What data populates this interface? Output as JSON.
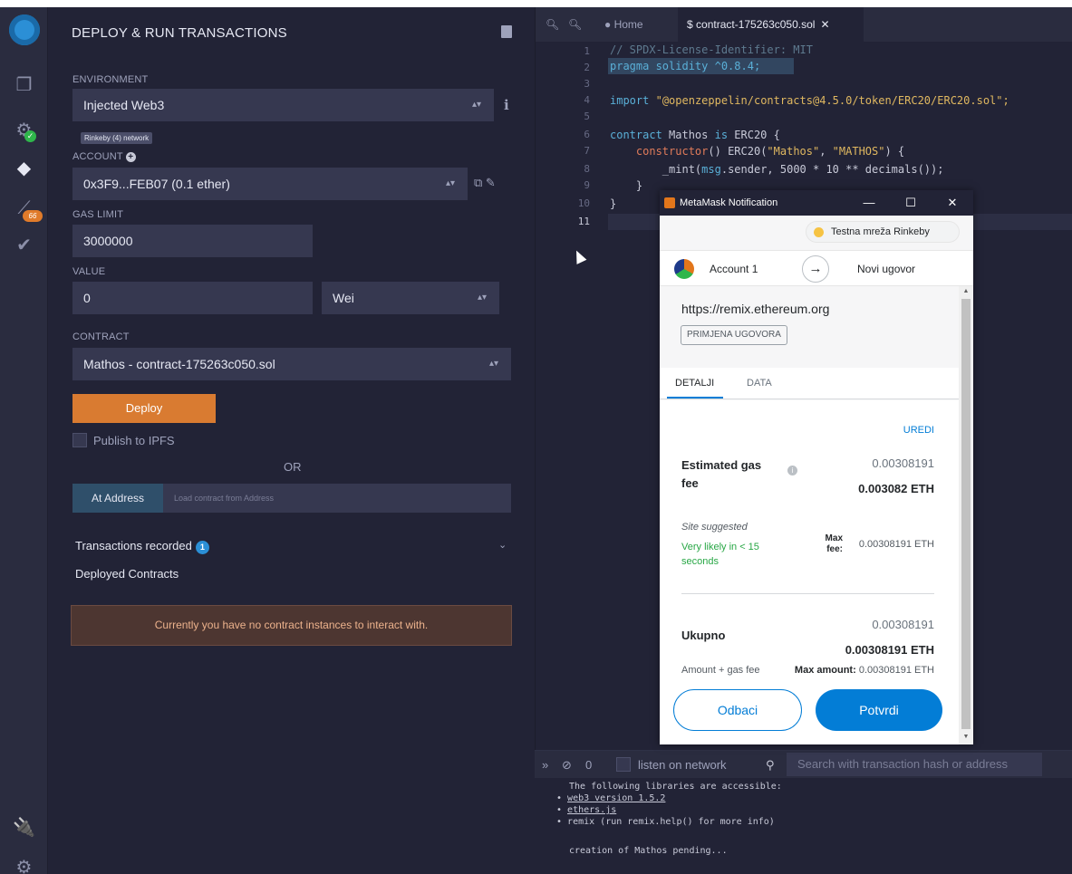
{
  "panel": {
    "title": "DEPLOY & RUN TRANSACTIONS",
    "env_label": "ENVIRONMENT",
    "env_value": "Injected Web3",
    "network_badge": "Rinkeby (4) network",
    "account_label": "ACCOUNT",
    "account_value": "0x3F9...FEB07 (0.1 ether)",
    "gas_label": "GAS LIMIT",
    "gas_value": "3000000",
    "value_label": "VALUE",
    "value_amount": "0",
    "value_unit": "Wei",
    "contract_label": "CONTRACT",
    "contract_value": "Mathos - contract-175263c050.sol",
    "deploy_label": "Deploy",
    "publish_label": "Publish to IPFS",
    "or_label": "OR",
    "at_address_label": "At Address",
    "at_address_placeholder": "Load contract from Address",
    "tx_recorded_label": "Transactions recorded",
    "tx_recorded_count": "1",
    "deployed_label": "Deployed Contracts",
    "no_instances": "Currently you have no contract instances to interact with."
  },
  "iconbar": {
    "compiler_badge": "66"
  },
  "editor": {
    "tabs": [
      {
        "label": "Home"
      },
      {
        "label": "contract-175263c050.sol"
      }
    ],
    "line_numbers": [
      "1",
      "2",
      "3",
      "4",
      "5",
      "6",
      "7",
      "8",
      "9",
      "10",
      "11"
    ],
    "code": {
      "l1": "// SPDX-License-Identifier: MIT",
      "l2": "pragma solidity ^0.8.4;",
      "l4_kw": "import",
      "l4_str": "\"@openzeppelin/contracts@4.5.0/token/ERC20/ERC20.sol\";",
      "l6_kw": "contract",
      "l6_rest": " Mathos ",
      "l6_kw2": "is",
      "l6_end": " ERC20 {",
      "l7_fn": "constructor",
      "l7_mid": "() ERC20(",
      "l7_s1": "\"Mathos\"",
      "l7_comma": ", ",
      "l7_s2": "\"MATHOS\"",
      "l7_end": ") {",
      "l8_a": "_mint(",
      "l8_msg": "msg",
      "l8_b": ".sender, 5000 * 10 ** decimals());",
      "l9": "}",
      "l10": "}"
    }
  },
  "terminal": {
    "tx_count": "0",
    "listen_label": "listen on network",
    "search_placeholder": "Search with transaction hash or address",
    "line1": "The following libraries are accessible:",
    "line2": "web3 version 1.5.2",
    "line3": "ethers.js",
    "line4": "remix (run remix.help() for more info)",
    "line5": "creation of Mathos pending..."
  },
  "metamask": {
    "window_title": "MetaMask Notification",
    "network": "Testna mreža Rinkeby",
    "account": "Account 1",
    "action": "Novi ugovor",
    "origin": "https://remix.ethereum.org",
    "badge": "PRIMJENA UGOVORA",
    "tab_details": "DETALJI",
    "tab_data": "DATA",
    "edit": "UREDI",
    "gas_label": "Estimated gas fee",
    "gas_value": "0.00308191",
    "gas_value_eth": "0.003082 ETH",
    "site_suggested": "Site suggested",
    "likely": "Very likely in < 15 seconds",
    "max_fee_label": "Max fee:",
    "max_fee_value": "0.00308191 ETH",
    "total_label": "Ukupno",
    "total_value": "0.00308191",
    "total_value_eth": "0.00308191 ETH",
    "amount_label": "Amount + gas fee",
    "max_amount_label": "Max amount:",
    "max_amount_value": "0.00308191 ETH",
    "cancel": "Odbaci",
    "confirm": "Potvrdi"
  }
}
